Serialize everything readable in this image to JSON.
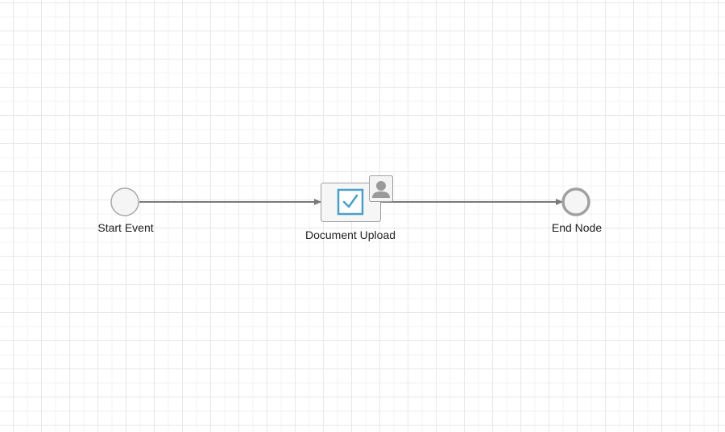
{
  "diagram": {
    "nodes": [
      {
        "id": "start",
        "type": "start-event",
        "label": "Start Event"
      },
      {
        "id": "task",
        "type": "user-task",
        "label": "Document Upload",
        "icon": "checkbox-icon",
        "badge_icon": "user-icon"
      },
      {
        "id": "end",
        "type": "end-event",
        "label": "End Node"
      }
    ],
    "edges": [
      {
        "from": "start",
        "to": "task"
      },
      {
        "from": "task",
        "to": "end"
      }
    ],
    "colors": {
      "grid": "#e8e8e8",
      "edge": "#7a7a7a",
      "node_stroke": "#a0a0a0",
      "task_fill": "#f5f5f5",
      "checkbox": "#4a9fc6",
      "user_icon": "#9a9a9a"
    }
  }
}
